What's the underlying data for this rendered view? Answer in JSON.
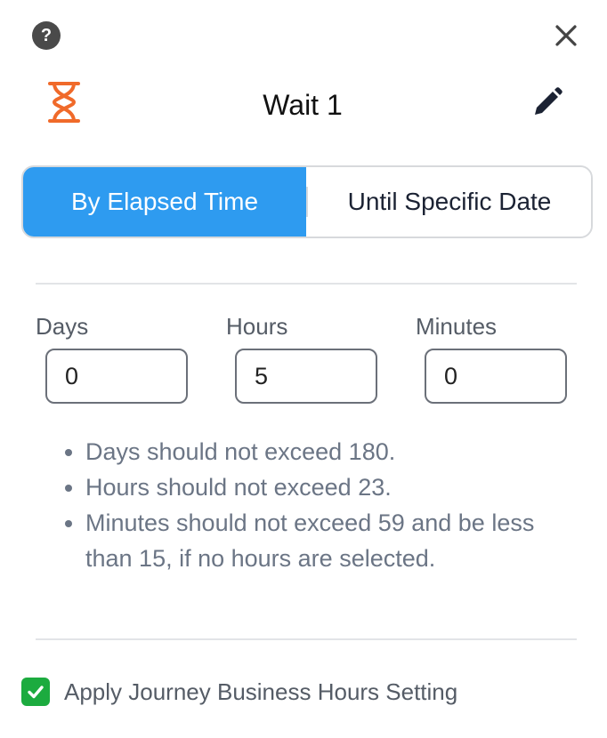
{
  "header": {
    "title": "Wait 1",
    "help_icon": "help-icon",
    "help_glyph": "?",
    "close_icon": "close-icon",
    "node_icon": "hourglass-icon",
    "edit_icon": "pencil-icon"
  },
  "mode_toggle": {
    "options": [
      "By Elapsed Time",
      "Until Specific Date"
    ],
    "selected": "By Elapsed Time"
  },
  "duration": {
    "days": {
      "label": "Days",
      "value": "0"
    },
    "hours": {
      "label": "Hours",
      "value": "5"
    },
    "minutes": {
      "label": "Minutes",
      "value": "0"
    }
  },
  "rules": [
    "Days should not exceed 180.",
    "Hours should not exceed 23.",
    "Minutes should not exceed 59 and be less than 15, if no hours are selected."
  ],
  "business_hours": {
    "label": "Apply Journey Business Hours Setting",
    "checked": true
  },
  "colors": {
    "accent": "#2e9bf0",
    "hourglass": "#f06a2a",
    "checkbox": "#1cab3f"
  }
}
